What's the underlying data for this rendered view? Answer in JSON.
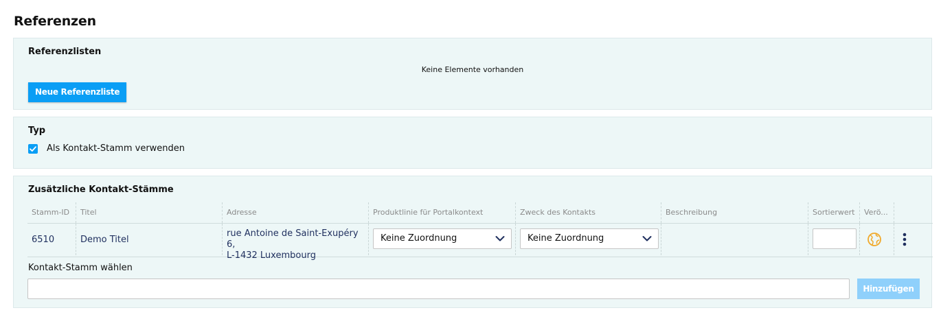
{
  "page": {
    "title": "Referenzen"
  },
  "reference_lists": {
    "title": "Referenzlisten",
    "empty_message": "Keine Elemente vorhanden",
    "new_button": "Neue Referenzliste"
  },
  "type": {
    "title": "Typ",
    "checkbox_label": "Als Kontakt-Stamm verwenden",
    "checkbox_checked": true
  },
  "additional": {
    "title": "Zusätzliche Kontakt-Stämme",
    "columns": [
      "Stamm-ID",
      "Titel",
      "Adresse",
      "Produktlinie für Portalkontext",
      "Zweck des Kontakts",
      "Beschreibung",
      "Sortierwert",
      "Verö..."
    ],
    "rows": [
      {
        "stamm_id": "6510",
        "titel": "Demo Titel",
        "adresse_line1": "rue Antoine de Saint-Exupéry 6,",
        "adresse_line2": "L-1432 Luxembourg",
        "produktlinie": "Keine Zuordnung",
        "zweck": "Keine Zuordnung",
        "beschreibung": "",
        "sortierwert": "",
        "published_icon": "globe-icon",
        "actions_icon": "kebab-menu-icon"
      }
    ],
    "select_label": "Kontakt-Stamm wählen",
    "select_value": "",
    "add_button": "Hinzufügen"
  },
  "colors": {
    "accent": "#0a9ef5",
    "accent_disabled": "#8fd0fb",
    "panel_bg": "#edf7f7",
    "link_text": "#1f2f5e",
    "globe": "#f0a92b"
  }
}
